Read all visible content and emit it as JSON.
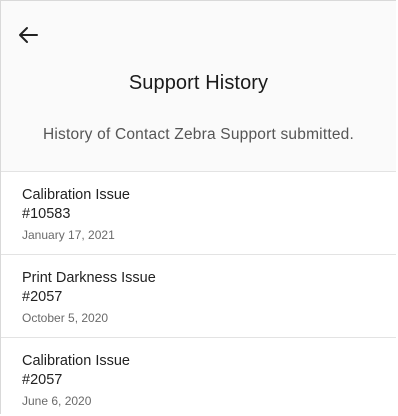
{
  "header": {
    "back_icon": "arrow-left-icon",
    "title": "Support History",
    "subtitle": "History of Contact Zebra Support submitted."
  },
  "tickets": [
    {
      "issue": "Calibration Issue",
      "number": "#10583",
      "date": "January 17, 2021"
    },
    {
      "issue": "Print Darkness Issue",
      "number": "#2057",
      "date": "October 5, 2020"
    },
    {
      "issue": "Calibration Issue",
      "number": "#2057",
      "date": "June 6, 2020"
    }
  ],
  "colors": {
    "header_background": "#fafafa",
    "divider": "#e3e3e3",
    "title_text": "#1a1a1a",
    "date_text": "#6a6a6a"
  }
}
